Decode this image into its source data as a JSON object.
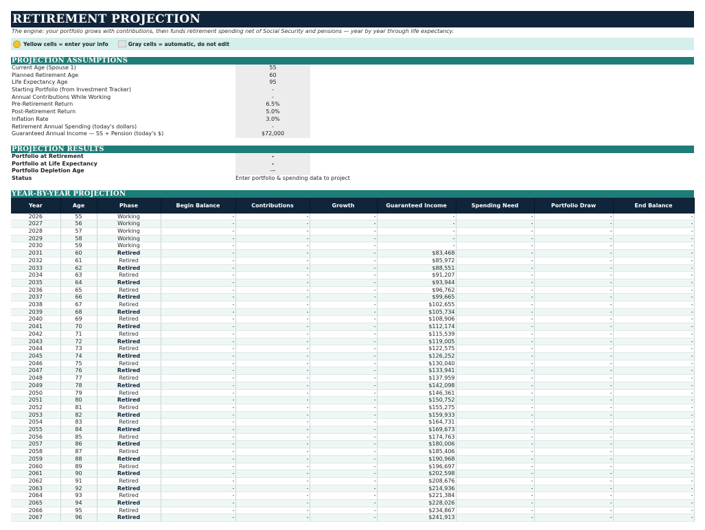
{
  "title": "RETIREMENT PROJECTION",
  "subtitle": "The engine: your portfolio grows with contributions, then funds retirement spending net of Social Security and pensions — year by year through life expectancy.",
  "legend": {
    "yellow_label": "Yellow cells = enter your info",
    "gray_label": "Gray cells = automatic, do not edit",
    "yellow_color": "#f2c230",
    "gray_color": "#e2e2e2"
  },
  "colors": {
    "navy": "#10243a",
    "teal": "#1e7d78",
    "mint": "#d4efec"
  },
  "assumptions": {
    "heading": "PROJECTION ASSUMPTIONS",
    "rows": [
      {
        "label": "Current Age (Spouse 1)",
        "value": "55"
      },
      {
        "label": "Planned Retirement Age",
        "value": "60"
      },
      {
        "label": "Life Expectancy Age",
        "value": "95"
      },
      {
        "label": "Starting Portfolio (from Investment Tracker)",
        "value": "-"
      },
      {
        "label": "Annual Contributions While Working",
        "value": "-"
      },
      {
        "label": "Pre-Retirement Return",
        "value": "6.5%"
      },
      {
        "label": "Post-Retirement Return",
        "value": "5.0%"
      },
      {
        "label": "Inflation Rate",
        "value": "3.0%"
      },
      {
        "label": "Retirement Annual Spending (today's dollars)",
        "value": "-"
      },
      {
        "label": "Guaranteed Annual Income — SS + Pension (today's $)",
        "value": "$72,000"
      }
    ]
  },
  "results": {
    "heading": "PROJECTION RESULTS",
    "portfolio_at_retirement_label": "Portfolio at Retirement",
    "portfolio_at_retirement_value": "-",
    "portfolio_at_life_expectancy_label": "Portfolio at Life Expectancy",
    "portfolio_at_life_expectancy_value": "-",
    "depletion_age_label": "Portfolio Depletion Age",
    "depletion_age_value": "—",
    "status_label": "Status",
    "status_value": "Enter portfolio & spending data to project"
  },
  "projection": {
    "heading": "YEAR-BY-YEAR PROJECTION",
    "columns": [
      "Year",
      "Age",
      "Phase",
      "Begin Balance",
      "Contributions",
      "Growth",
      "Guaranteed Income",
      "Spending Need",
      "Portfolio Draw",
      "End Balance"
    ],
    "rows": [
      [
        "2026",
        "55",
        "Working",
        "-",
        "-",
        "-",
        "-",
        "-",
        "-",
        "-"
      ],
      [
        "2027",
        "56",
        "Working",
        "-",
        "-",
        "-",
        "-",
        "-",
        "-",
        "-"
      ],
      [
        "2028",
        "57",
        "Working",
        "-",
        "-",
        "-",
        "-",
        "-",
        "-",
        "-"
      ],
      [
        "2029",
        "58",
        "Working",
        "-",
        "-",
        "-",
        "-",
        "-",
        "-",
        "-"
      ],
      [
        "2030",
        "59",
        "Working",
        "-",
        "-",
        "-",
        "-",
        "-",
        "-",
        "-"
      ],
      [
        "2031",
        "60",
        "Retired",
        "-",
        "-",
        "-",
        "$83,468",
        "-",
        "-",
        "-"
      ],
      [
        "2032",
        "61",
        "Retired",
        "-",
        "-",
        "-",
        "$85,972",
        "-",
        "-",
        "-"
      ],
      [
        "2033",
        "62",
        "Retired",
        "-",
        "-",
        "-",
        "$88,551",
        "-",
        "-",
        "-"
      ],
      [
        "2034",
        "63",
        "Retired",
        "-",
        "-",
        "-",
        "$91,207",
        "-",
        "-",
        "-"
      ],
      [
        "2035",
        "64",
        "Retired",
        "-",
        "-",
        "-",
        "$93,944",
        "-",
        "-",
        "-"
      ],
      [
        "2036",
        "65",
        "Retired",
        "-",
        "-",
        "-",
        "$96,762",
        "-",
        "-",
        "-"
      ],
      [
        "2037",
        "66",
        "Retired",
        "-",
        "-",
        "-",
        "$99,665",
        "-",
        "-",
        "-"
      ],
      [
        "2038",
        "67",
        "Retired",
        "-",
        "-",
        "-",
        "$102,655",
        "-",
        "-",
        "-"
      ],
      [
        "2039",
        "68",
        "Retired",
        "-",
        "-",
        "-",
        "$105,734",
        "-",
        "-",
        "-"
      ],
      [
        "2040",
        "69",
        "Retired",
        "-",
        "-",
        "-",
        "$108,906",
        "-",
        "-",
        "-"
      ],
      [
        "2041",
        "70",
        "Retired",
        "-",
        "-",
        "-",
        "$112,174",
        "-",
        "-",
        "-"
      ],
      [
        "2042",
        "71",
        "Retired",
        "-",
        "-",
        "-",
        "$115,539",
        "-",
        "-",
        "-"
      ],
      [
        "2043",
        "72",
        "Retired",
        "-",
        "-",
        "-",
        "$119,005",
        "-",
        "-",
        "-"
      ],
      [
        "2044",
        "73",
        "Retired",
        "-",
        "-",
        "-",
        "$122,575",
        "-",
        "-",
        "-"
      ],
      [
        "2045",
        "74",
        "Retired",
        "-",
        "-",
        "-",
        "$126,252",
        "-",
        "-",
        "-"
      ],
      [
        "2046",
        "75",
        "Retired",
        "-",
        "-",
        "-",
        "$130,040",
        "-",
        "-",
        "-"
      ],
      [
        "2047",
        "76",
        "Retired",
        "-",
        "-",
        "-",
        "$133,941",
        "-",
        "-",
        "-"
      ],
      [
        "2048",
        "77",
        "Retired",
        "-",
        "-",
        "-",
        "$137,959",
        "-",
        "-",
        "-"
      ],
      [
        "2049",
        "78",
        "Retired",
        "-",
        "-",
        "-",
        "$142,098",
        "-",
        "-",
        "-"
      ],
      [
        "2050",
        "79",
        "Retired",
        "-",
        "-",
        "-",
        "$146,361",
        "-",
        "-",
        "-"
      ],
      [
        "2051",
        "80",
        "Retired",
        "-",
        "-",
        "-",
        "$150,752",
        "-",
        "-",
        "-"
      ],
      [
        "2052",
        "81",
        "Retired",
        "-",
        "-",
        "-",
        "$155,275",
        "-",
        "-",
        "-"
      ],
      [
        "2053",
        "82",
        "Retired",
        "-",
        "-",
        "-",
        "$159,933",
        "-",
        "-",
        "-"
      ],
      [
        "2054",
        "83",
        "Retired",
        "-",
        "-",
        "-",
        "$164,731",
        "-",
        "-",
        "-"
      ],
      [
        "2055",
        "84",
        "Retired",
        "-",
        "-",
        "-",
        "$169,673",
        "-",
        "-",
        "-"
      ],
      [
        "2056",
        "85",
        "Retired",
        "-",
        "-",
        "-",
        "$174,763",
        "-",
        "-",
        "-"
      ],
      [
        "2057",
        "86",
        "Retired",
        "-",
        "-",
        "-",
        "$180,006",
        "-",
        "-",
        "-"
      ],
      [
        "2058",
        "87",
        "Retired",
        "-",
        "-",
        "-",
        "$185,406",
        "-",
        "-",
        "-"
      ],
      [
        "2059",
        "88",
        "Retired",
        "-",
        "-",
        "-",
        "$190,968",
        "-",
        "-",
        "-"
      ],
      [
        "2060",
        "89",
        "Retired",
        "-",
        "-",
        "-",
        "$196,697",
        "-",
        "-",
        "-"
      ],
      [
        "2061",
        "90",
        "Retired",
        "-",
        "-",
        "-",
        "$202,598",
        "-",
        "-",
        "-"
      ],
      [
        "2062",
        "91",
        "Retired",
        "-",
        "-",
        "-",
        "$208,676",
        "-",
        "-",
        "-"
      ],
      [
        "2063",
        "92",
        "Retired",
        "-",
        "-",
        "-",
        "$214,936",
        "-",
        "-",
        "-"
      ],
      [
        "2064",
        "93",
        "Retired",
        "-",
        "-",
        "-",
        "$221,384",
        "-",
        "-",
        "-"
      ],
      [
        "2065",
        "94",
        "Retired",
        "-",
        "-",
        "-",
        "$228,026",
        "-",
        "-",
        "-"
      ],
      [
        "2066",
        "95",
        "Retired",
        "-",
        "-",
        "-",
        "$234,867",
        "-",
        "-",
        "-"
      ],
      [
        "2067",
        "96",
        "Retired",
        "-",
        "-",
        "-",
        "$241,913",
        "-",
        "-",
        "-"
      ]
    ]
  }
}
